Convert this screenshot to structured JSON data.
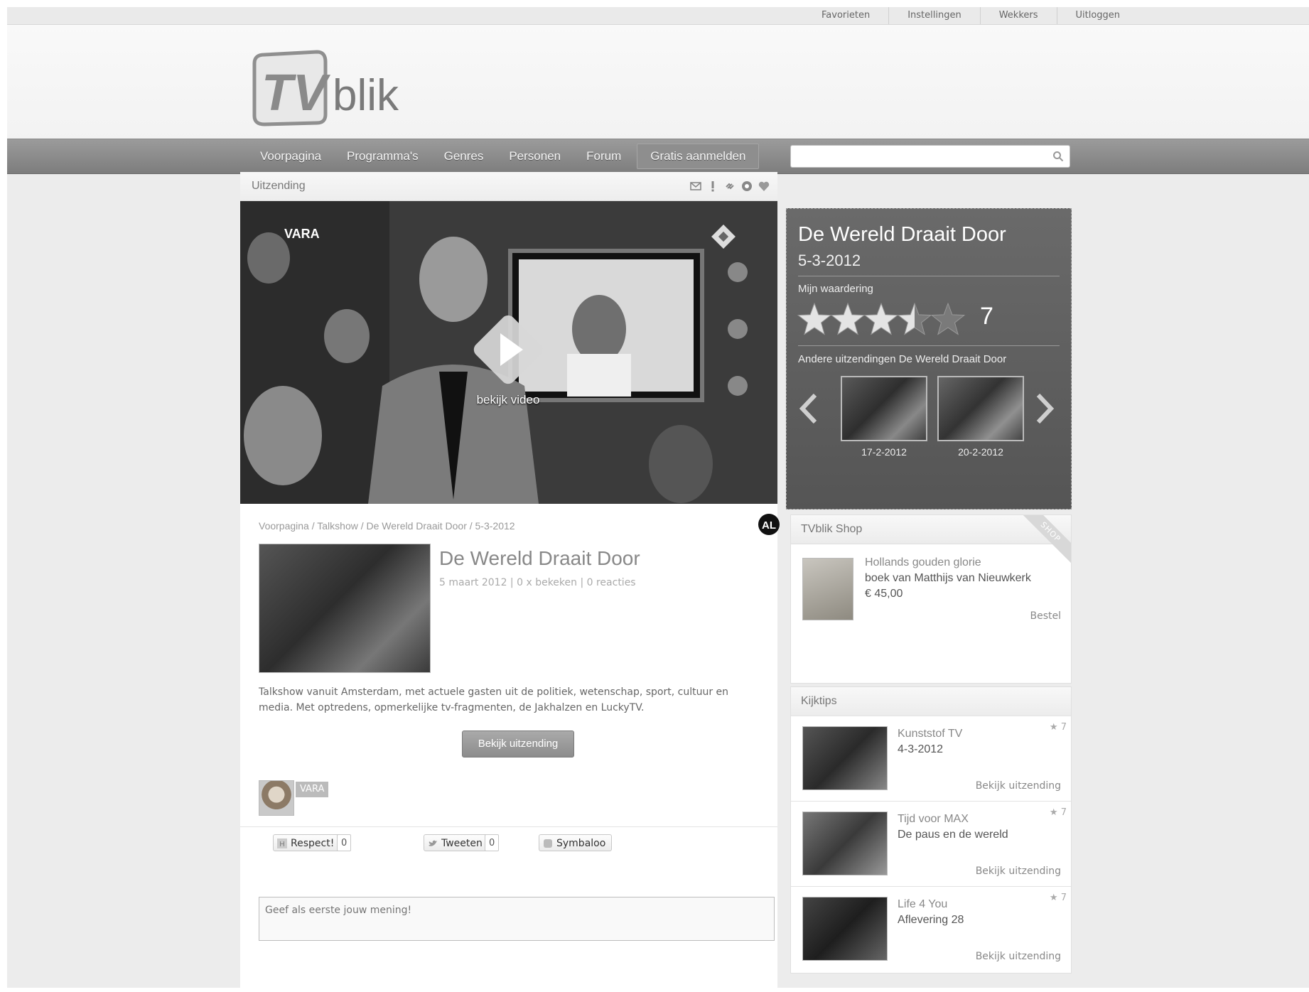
{
  "top_links": [
    "Favorieten",
    "Instellingen",
    "Wekkers",
    "Uitloggen"
  ],
  "logo": {
    "text_tv": "TV",
    "text_blik": "blik"
  },
  "nav": {
    "items": [
      "Voorpagina",
      "Programma's",
      "Genres",
      "Personen",
      "Forum"
    ],
    "cta": "Gratis aanmelden"
  },
  "search": {
    "placeholder": ""
  },
  "broadcast": {
    "section_title": "Uitzending",
    "play_caption": "bekijk video",
    "channel_logo": "VARA"
  },
  "info_panel": {
    "title": "De Wereld Draait Door",
    "date": "5-3-2012",
    "rating_label": "Mijn waardering",
    "rating": 3.5,
    "rating_max": 5,
    "score": "7",
    "other_label": "Andere uitzendingen De Wereld Draait Door",
    "other_episodes": [
      {
        "date": "17-2-2012"
      },
      {
        "date": "20-2-2012"
      }
    ]
  },
  "breadcrumb": "Voorpagina / Talkshow / De Wereld Draait Door / 5-3-2012",
  "age_badge": "AL",
  "article": {
    "title": "De Wereld Draait Door",
    "meta": "5 maart 2012 | 0 x bekeken | 0 reacties",
    "description": "Talkshow vanuit Amsterdam, met actuele gasten uit de politiek, wetenschap, sport, cultuur en media. Met optredens, opmerkelijke tv-fragmenten, de Jakhalzen en LuckyTV.",
    "watch_button": "Bekijk uitzending",
    "broadcaster_tag": "VARA"
  },
  "share": {
    "respect_label": "Respect!",
    "respect_count": "0",
    "tweet_label": "Tweeten",
    "tweet_count": "0",
    "symbaloo_label": "Symbaloo"
  },
  "comment": {
    "placeholder": "Geef als eerste jouw mening!"
  },
  "shop": {
    "title": "TVblik Shop",
    "ribbon": "SHOP",
    "item_title": "Hollands gouden glorie",
    "item_subtitle": "boek van Matthijs van Nieuwkerk",
    "item_price": "€ 45,00",
    "order_label": "Bestel"
  },
  "kijktips": {
    "title": "Kijktips",
    "items": [
      {
        "title": "Kunststof TV",
        "subtitle": "4-3-2012",
        "rating": "7",
        "link": "Bekijk uitzending"
      },
      {
        "title": "Tijd voor MAX",
        "subtitle": "De paus en de wereld",
        "rating": "7",
        "link": "Bekijk uitzending"
      },
      {
        "title": "Life 4 You",
        "subtitle": "Aflevering 28",
        "rating": "7",
        "link": "Bekijk uitzending"
      }
    ]
  }
}
